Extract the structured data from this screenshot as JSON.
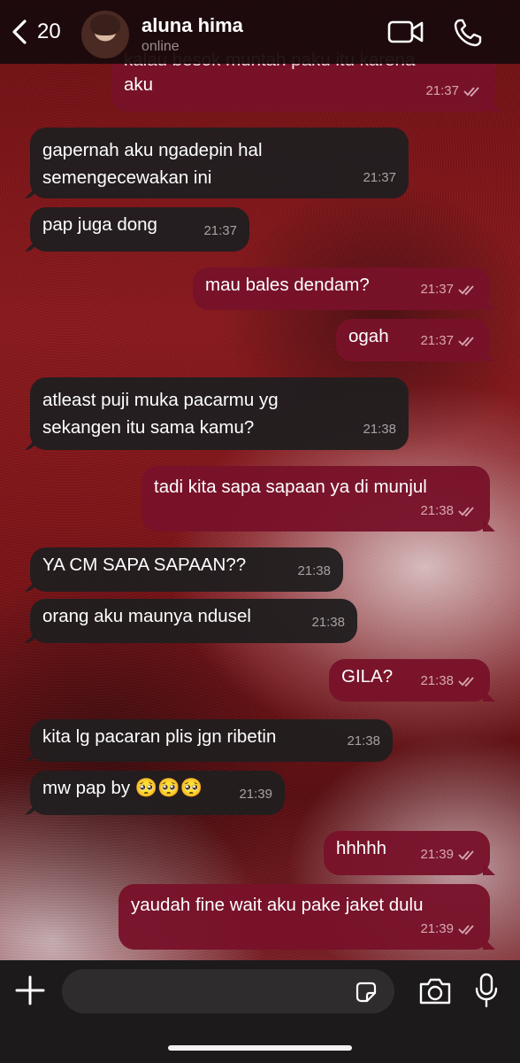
{
  "header": {
    "back_count": "20",
    "contact_name": "aluna hima",
    "status": "online"
  },
  "messages": [
    {
      "dir": "out",
      "text": "kalau besok muntah paku itu karena",
      "text2": "aku",
      "time": "21:37"
    },
    {
      "dir": "in",
      "text": "gapernah aku ngadepin hal",
      "text2": "semengecewakan ini",
      "time": "21:37"
    },
    {
      "dir": "in",
      "text": "pap juga dong",
      "time": "21:37"
    },
    {
      "dir": "out",
      "text": "mau bales dendam?",
      "time": "21:37"
    },
    {
      "dir": "out",
      "text": "ogah",
      "time": "21:37"
    },
    {
      "dir": "in",
      "text": "atleast puji muka pacarmu yg",
      "text2": "sekangen itu sama kamu?",
      "time": "21:38"
    },
    {
      "dir": "out",
      "text": "tadi kita sapa sapaan ya di munjul",
      "time": "21:38"
    },
    {
      "dir": "in",
      "text": "YA CM SAPA SAPAAN??",
      "time": "21:38"
    },
    {
      "dir": "in",
      "text": "orang aku maunya ndusel",
      "time": "21:38"
    },
    {
      "dir": "out",
      "text": "GILA?",
      "time": "21:38"
    },
    {
      "dir": "in",
      "text": "kita lg pacaran plis jgn ribetin",
      "time": "21:38"
    },
    {
      "dir": "in",
      "text": "mw pap by 🥺🥺🥺",
      "time": "21:39"
    },
    {
      "dir": "out",
      "text": "hhhhh",
      "time": "21:39"
    },
    {
      "dir": "out",
      "text": "yaudah fine wait aku pake jaket dulu",
      "time": "21:39"
    }
  ],
  "composer": {
    "value": "",
    "placeholder": ""
  },
  "colors": {
    "incoming_bubble": "#211e1f",
    "outgoing_bubble": "#78122a",
    "header_bg": "#180a0c"
  },
  "icons": [
    "chevron-left-icon",
    "video-call-icon",
    "phone-icon",
    "plus-icon",
    "sticker-icon",
    "camera-icon",
    "microphone-icon",
    "double-check-icon"
  ]
}
